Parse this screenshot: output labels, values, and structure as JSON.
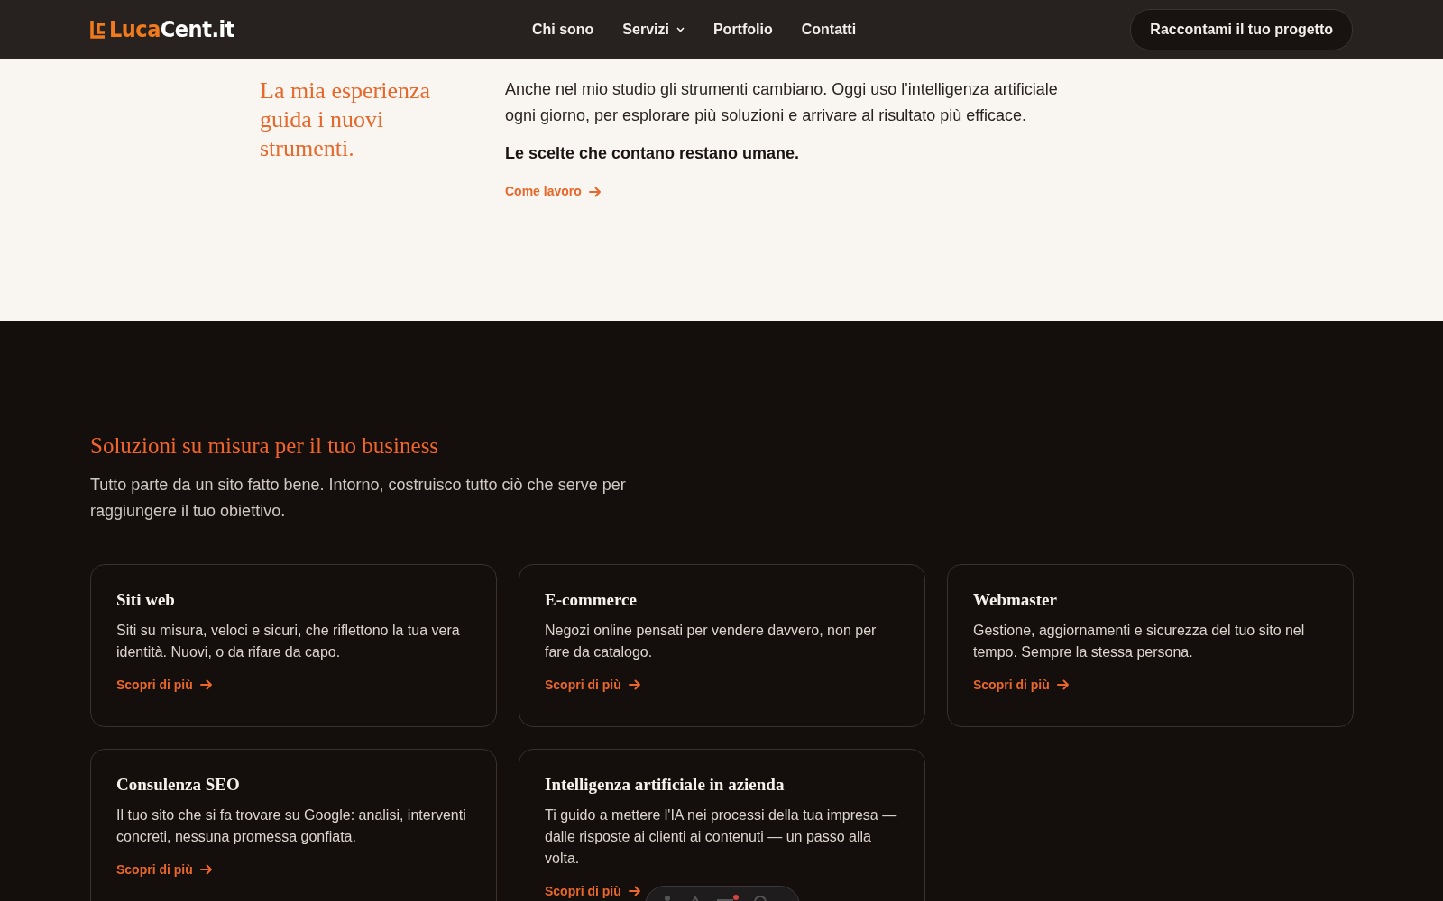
{
  "navbar": {
    "logo": {
      "part_1": "Luca",
      "part_2": "Cent.it"
    },
    "links": [
      {
        "label": "Chi sono",
        "has_menu": false
      },
      {
        "label": "Servizi",
        "has_menu": true
      },
      {
        "label": "Portfolio",
        "has_menu": false
      },
      {
        "label": "Contatti",
        "has_menu": false
      }
    ],
    "cta": "Raccontami il tuo progetto"
  },
  "intro": {
    "heading": "La mia esperienza guida i nuovi strumenti.",
    "paragraph": "Anche nel mio studio gli strumenti cambiano. Oggi uso l'intelligenza artificiale ogni giorno, per esplorare più soluzioni e arrivare al risultato più efficace.",
    "statement": "Le scelte che contano restano umane.",
    "link": "Come lavoro"
  },
  "services": {
    "heading": "Soluzioni su misura per il tuo business",
    "subheading": "Tutto parte da un sito fatto bene. Intorno, costruisco tutto ciò che serve per raggiungere il tuo obiettivo.",
    "cards": [
      {
        "title": "Siti web",
        "text": "Siti su misura, veloci e sicuri, che riflettono la tua vera identità. Nuovi, o da rifare da capo.",
        "link": "Scopri di più"
      },
      {
        "title": "E-commerce",
        "text": "Negozi online pensati per vendere davvero, non per fare da catalogo.",
        "link": "Scopri di più"
      },
      {
        "title": "Webmaster",
        "text": "Gestione, aggiornamenti e sicurezza del tuo sito nel tempo. Sempre la stessa persona.",
        "link": "Scopri di più"
      },
      {
        "title": "Consulenza SEO",
        "text": "Il tuo sito che si fa trovare su Google: analisi, interventi concreti, nessuna promessa gonfiata.",
        "link": "Scopri di più"
      },
      {
        "title": "Intelligenza artificiale in azienda",
        "text": "Ti guido a mettere l'IA nei processi della tua impresa — dalle risposte ai clienti ai contenuti — un passo alla volta.",
        "link": "Scopri di più"
      }
    ]
  }
}
